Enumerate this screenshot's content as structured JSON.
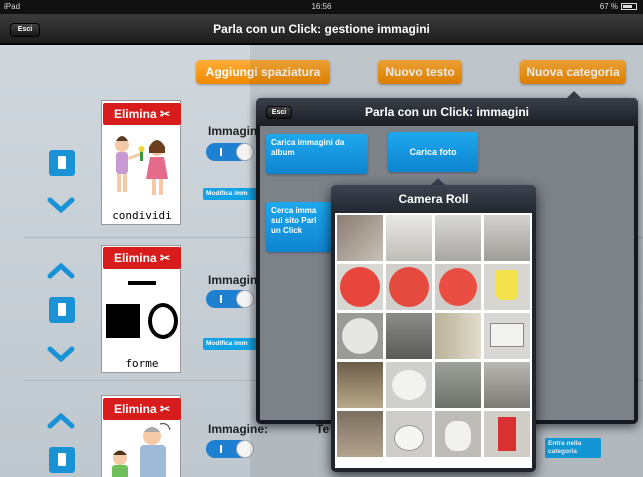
{
  "status": {
    "device": "iPad",
    "time": "16:56",
    "battery": "67 %"
  },
  "nav": {
    "title": "Parla con un Click: gestione immagini",
    "esc": "Esci"
  },
  "toolbar": {
    "add_spacing": "Aggiungi spaziatura",
    "new_text": "Nuovo testo",
    "new_category": "Nuova categoria"
  },
  "rows": [
    {
      "delete": "Elimina",
      "word": "condividi",
      "image_label": "Immagin",
      "modify": "Modifica imm"
    },
    {
      "delete": "Elimina",
      "word": "forme",
      "image_label": "Immagin",
      "modify": "Modifica imm"
    },
    {
      "delete": "Elimina",
      "word": "",
      "image_label": "Immagine:",
      "modify": ""
    }
  ],
  "row3_extra": {
    "text_label": "Te",
    "enter_category": "Entra nella categoria"
  },
  "popover": {
    "title": "Parla con un Click: immagini",
    "esc": "Esci",
    "load_album": "Carica immagini da album",
    "load_photo": "Carica foto",
    "search_site": "Cerca imma sul sito Parl un Click"
  },
  "camera_roll": {
    "title": "Camera Roll"
  },
  "colors": {
    "orange": "#f59a14",
    "red": "#d81b1b",
    "blue": "#1a93d6"
  },
  "icons": [
    "chevron-up-icon",
    "chevron-down-icon",
    "document-icon",
    "scissors-icon",
    "toggle-switch"
  ]
}
